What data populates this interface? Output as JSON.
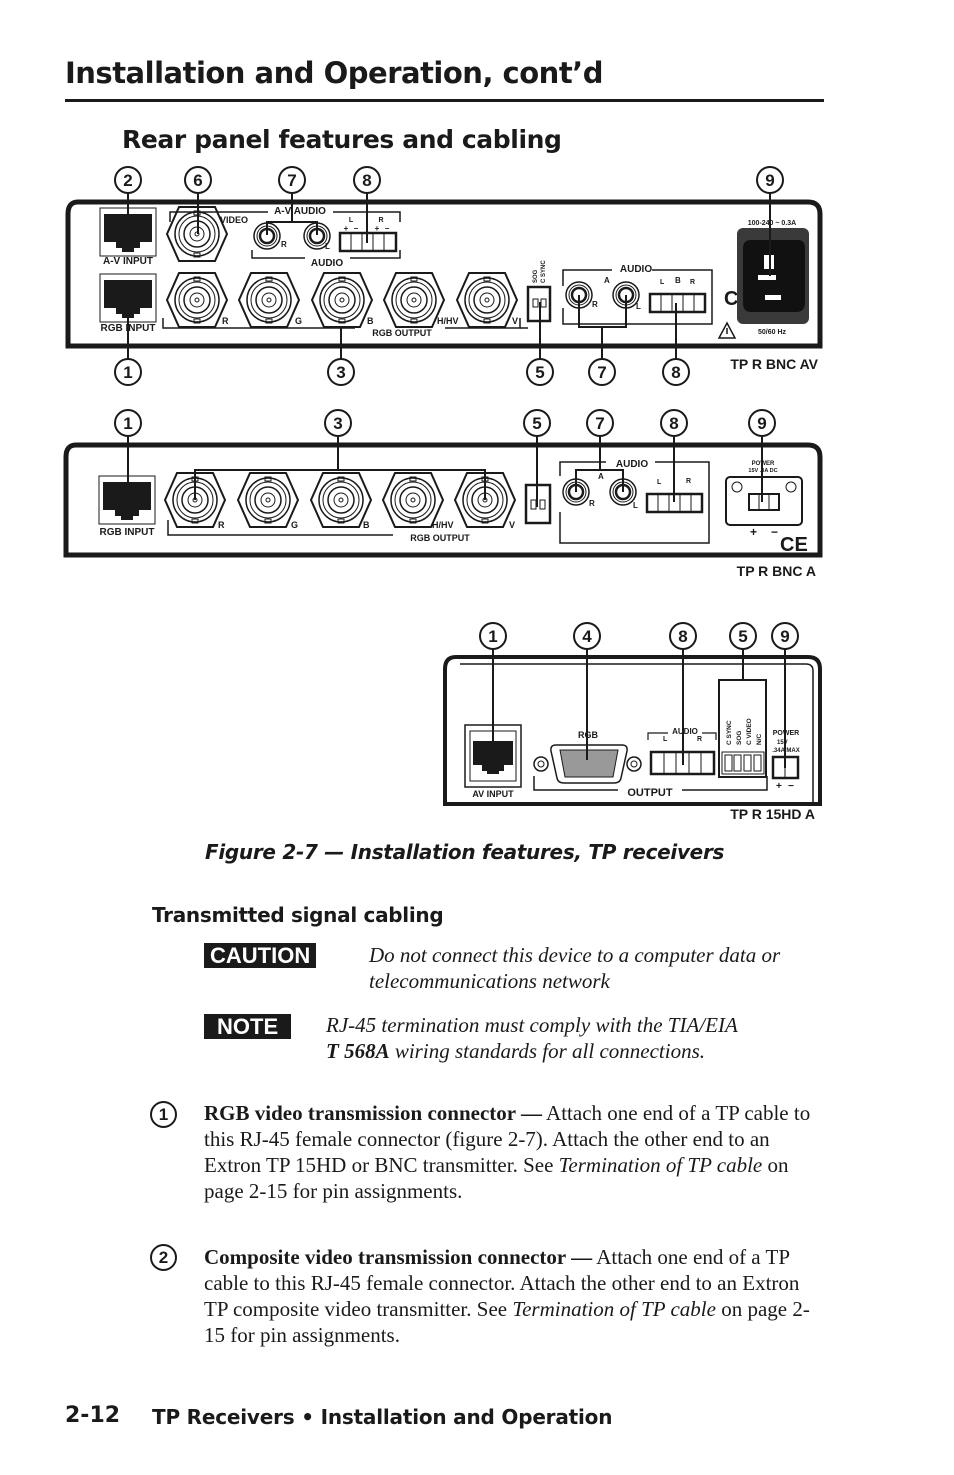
{
  "header": {
    "title": "Installation and Operation, cont’d",
    "section_title": "Rear panel features and cabling"
  },
  "figure": {
    "caption": "Figure 2-7 — Installation features, TP receivers",
    "panels": [
      {
        "model": "TP R BNC AV",
        "callouts_top": [
          "2",
          "6",
          "7",
          "8",
          "9"
        ],
        "callouts_bottom": [
          "1",
          "3",
          "5",
          "7",
          "8"
        ],
        "labels": {
          "av_input": "A-V INPUT",
          "rgb_input": "RGB INPUT",
          "video": "VIDEO",
          "av_audio": "A-V AUDIO",
          "audio_lower": "AUDIO",
          "r": "R",
          "l": "L",
          "g": "G",
          "b": "B",
          "hhv": "H/HV",
          "v": "V",
          "rgb_output": "RGB OUTPUT",
          "sog": "SOG",
          "c_sync": "C SYNC",
          "audio": "AUDIO",
          "a": "A",
          "plus": "+",
          "minus": "−",
          "voltage": "100-240 ~ 0.3A",
          "freq": "50/60 Hz",
          "ce": "CE"
        }
      },
      {
        "model": "TP R BNC A",
        "callouts_top": [
          "1",
          "3",
          "5",
          "7",
          "8",
          "9"
        ],
        "labels": {
          "rgb_input": "RGB INPUT",
          "r": "R",
          "g": "G",
          "b": "B",
          "hhv": "H/HV",
          "v": "V",
          "l": "L",
          "a": "A",
          "rgb_output": "RGB OUTPUT",
          "audio": "AUDIO",
          "power": "POWER",
          "power_spec": "15V .3A DC",
          "plus": "+",
          "minus": "−",
          "ce": "CE"
        }
      },
      {
        "model": "TP R 15HD A",
        "callouts_top": [
          "1",
          "4",
          "8",
          "5",
          "9"
        ],
        "labels": {
          "av_input": "AV INPUT",
          "rgb": "RGB",
          "audio": "AUDIO",
          "l": "L",
          "r": "R",
          "plus": "+",
          "minus": "−",
          "switches": [
            "C SYNC",
            "SOG",
            "C VIDEO",
            "N/C"
          ],
          "power": "POWER",
          "power_spec_1": "15V",
          "power_spec_2": ".34A MAX",
          "output": "OUTPUT"
        }
      }
    ]
  },
  "subsection": {
    "title": "Transmitted signal cabling",
    "caution": {
      "badge": "CAUTION",
      "text_line1": "Do not connect this device to a computer data or",
      "text_line2": "telecommunications network"
    },
    "note": {
      "badge": "NOTE",
      "text_line1": "RJ-45 termination must comply with the TIA/EIA",
      "text_bold": "T 568A",
      "text_line2_rest": " wiring standards for all connections."
    },
    "items": [
      {
        "number": "1",
        "title": "RGB video transmission connector —",
        "text_a": " Attach one end of a TP cable to this RJ-45 female connector (figure 2-7).  Attach the other end to an Extron TP 15HD or BNC transmitter.  See ",
        "ref": "Termination of TP cable",
        "text_b": " on page 2-15 for pin assignments."
      },
      {
        "number": "2",
        "title": "Composite video transmission connector —",
        "text_a": " Attach one end of a TP cable to this RJ-45 female connector.  Attach the other end to an Extron TP composite video transmitter.  See ",
        "ref": "Termination of TP cable",
        "text_b": " on page 2-15 for pin assignments."
      }
    ]
  },
  "footer": {
    "page_number": "2-12",
    "title": "TP Receivers • Installation and Operation"
  }
}
